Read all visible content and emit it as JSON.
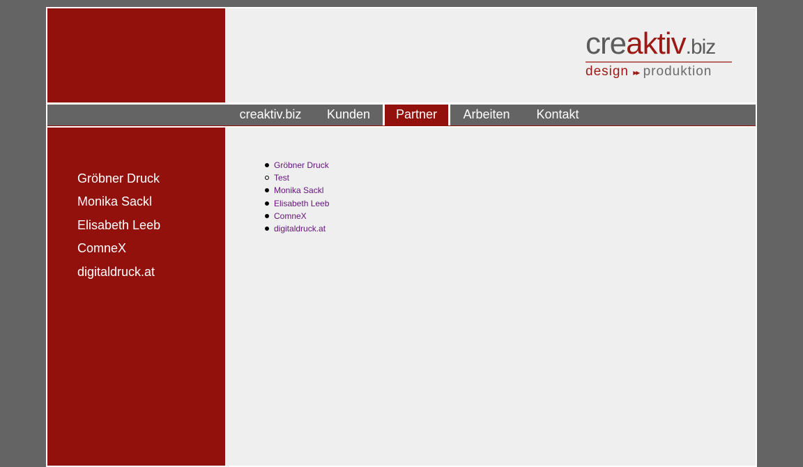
{
  "logo": {
    "main_part1": "cre",
    "main_accent": "aktiv",
    "main_suffix": ".biz",
    "sub_part1": "design",
    "sub_arrows": "▸▸",
    "sub_part2": "produktion"
  },
  "nav": {
    "items": [
      {
        "label": "creaktiv.biz"
      },
      {
        "label": "Kunden"
      },
      {
        "label": "Partner",
        "active": true
      },
      {
        "label": "Arbeiten"
      },
      {
        "label": "Kontakt"
      }
    ]
  },
  "sidebar": {
    "items": [
      {
        "label": "Gröbner Druck"
      },
      {
        "label": "Monika Sackl"
      },
      {
        "label": "Elisabeth Leeb"
      },
      {
        "label": "ComneX"
      },
      {
        "label": "digitaldruck.at"
      }
    ]
  },
  "content": {
    "list": [
      {
        "label": "Gröbner Druck",
        "bullet": "disc"
      },
      {
        "label": "Test",
        "bullet": "circle"
      },
      {
        "label": "Monika Sackl",
        "bullet": "disc"
      },
      {
        "label": "Elisabeth Leeb",
        "bullet": "disc"
      },
      {
        "label": "ComneX",
        "bullet": "disc"
      },
      {
        "label": "digitaldruck.at",
        "bullet": "disc"
      }
    ]
  },
  "colors": {
    "background": "#646464",
    "brand_red": "#92110c",
    "panel": "#efefef",
    "link": "#62127a"
  }
}
